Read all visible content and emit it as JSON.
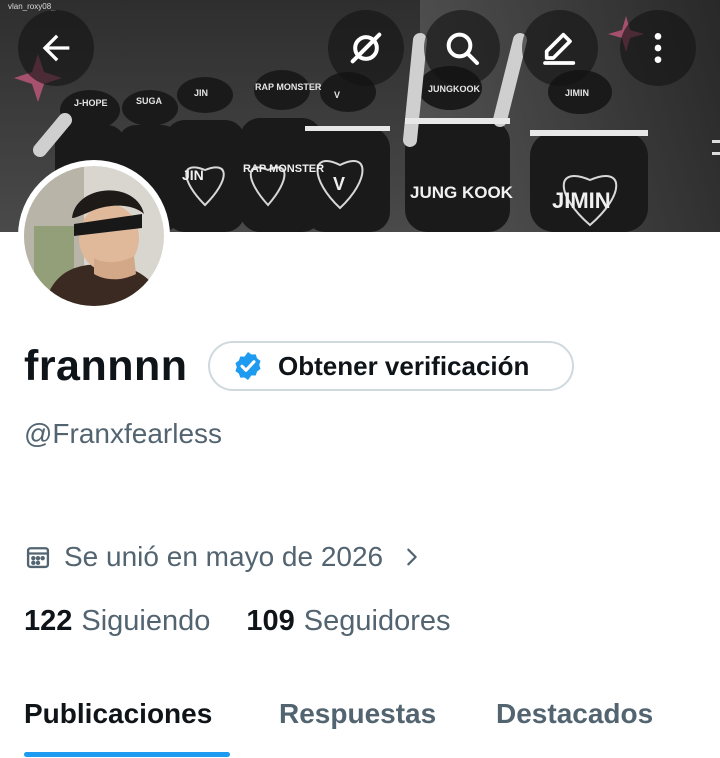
{
  "banner": {
    "watermark": "vlan_roxy08_",
    "jersey_names": [
      "JIN",
      "RAP MONSTER",
      "V",
      "JUNG KOOK",
      "JIMIN"
    ],
    "cap_names": [
      "J-HOPE",
      "SUGA",
      "JIN",
      "RAP MONSTER",
      "V",
      "JUNGKOOK",
      "JIMIN"
    ]
  },
  "toolbar": {
    "back": "back-arrow-icon",
    "grok": "grok-icon",
    "search": "search-icon",
    "edit": "edit-icon",
    "more": "more-vertical-icon"
  },
  "profile": {
    "display_name": "frannnn",
    "handle": "@Franxfearless",
    "verify_label": "Obtener verificación",
    "verify_color": "#1d9bf0",
    "joined": "Se unió en mayo de 2026"
  },
  "stats": {
    "following_count": "122",
    "following_label": "Siguiendo",
    "followers_count": "109",
    "followers_label": "Seguidores"
  },
  "tabs": [
    {
      "label": "Publicaciones",
      "active": true
    },
    {
      "label": "Respuestas",
      "active": false
    },
    {
      "label": "Destacados",
      "active": false
    }
  ],
  "colors": {
    "accent": "#1d9bf0",
    "secondary_text": "#536471"
  }
}
